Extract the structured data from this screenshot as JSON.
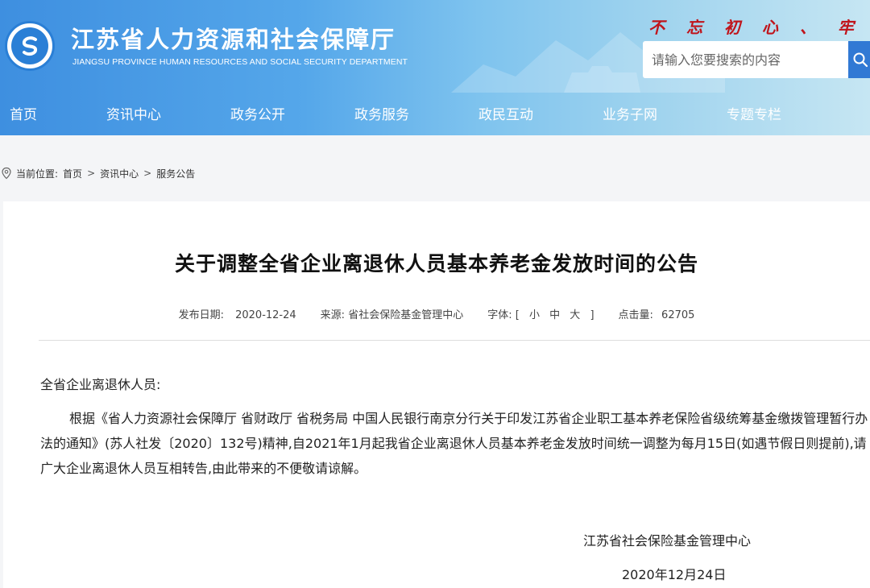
{
  "header": {
    "title": "江苏省人力资源和社会保障厅",
    "subtitle": "JIANGSU PROVINCE HUMAN RESOURCES AND SOCIAL SECURITY DEPARTMENT",
    "slogan": "不 忘 初 心 、 牢 记 使",
    "search_placeholder": "请输入您要搜索的内容",
    "logo_icon": "jiangsu-hrss-emblem",
    "search_icon": "magnifier-icon"
  },
  "nav": {
    "items": [
      {
        "label": "首页"
      },
      {
        "label": "资讯中心"
      },
      {
        "label": "政务公开"
      },
      {
        "label": "政务服务"
      },
      {
        "label": "政民互动"
      },
      {
        "label": "业务子网"
      },
      {
        "label": "专题专栏"
      }
    ]
  },
  "breadcrumb": {
    "prefix": "当前位置:",
    "items": [
      "首页",
      "资讯中心",
      "服务公告"
    ],
    "separator": ">"
  },
  "article": {
    "title": "关于调整全省企业离退休人员基本养老金发放时间的公告",
    "meta": {
      "date_label": "发布日期:",
      "date": "2020-12-24",
      "source_label": "来源:",
      "source": "省社会保险基金管理中心",
      "font_label": "字体:",
      "font_open": "[",
      "font_small": "小",
      "font_medium": "中",
      "font_large": "大",
      "font_close": "]",
      "hits_label": "点击量:",
      "hits": "62705"
    },
    "greeting": "全省企业离退休人员:",
    "body": "根据《省人力资源社会保障厅 省财政厅 省税务局 中国人民银行南京分行关于印发江苏省企业职工基本养老保险省级统筹基金缴拨管理暂行办法的通知》(苏人社发〔2020〕132号)精神,自2021年1月起我省企业离退休人员基本养老金发放时间统一调整为每月15日(如遇节假日则提前),请广大企业离退休人员互相转告,由此带来的不便敬请谅解。",
    "signature_org": "江苏省社会保险基金管理中心",
    "signature_date": "2020年12月24日"
  },
  "colors": {
    "header_blue": "#3e8fe0",
    "slogan_red": "#c0141b",
    "search_button": "#3179d4"
  }
}
